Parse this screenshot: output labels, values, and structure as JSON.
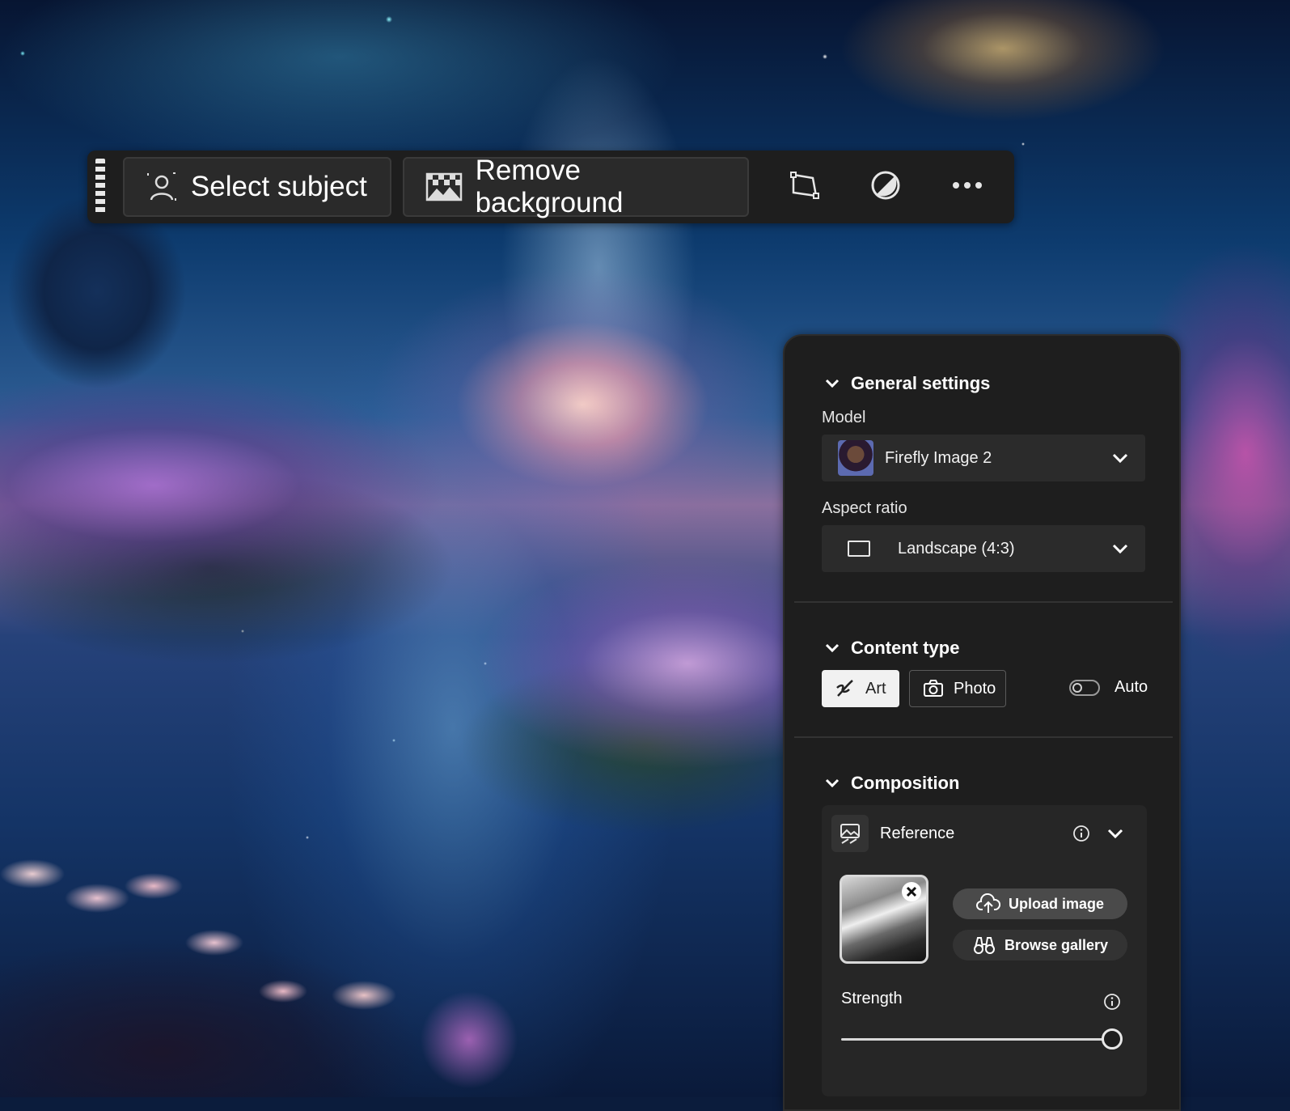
{
  "taskbar": {
    "select_subject_label": "Select subject",
    "remove_background_label": "Remove background"
  },
  "panel": {
    "general_settings": {
      "title": "General settings",
      "model_label": "Model",
      "model_value": "Firefly Image 2",
      "aspect_ratio_label": "Aspect ratio",
      "aspect_ratio_value": "Landscape (4:3)"
    },
    "content_type": {
      "title": "Content type",
      "art_label": "Art",
      "photo_label": "Photo",
      "selected": "Art",
      "auto_label": "Auto",
      "auto_enabled": false
    },
    "composition": {
      "title": "Composition",
      "reference_label": "Reference",
      "upload_label": "Upload image",
      "browse_label": "Browse gallery",
      "strength_label": "Strength",
      "strength_value": 1.0
    }
  },
  "icons": {
    "taskbar": [
      "select-subject-icon",
      "remove-background-icon",
      "transform-icon",
      "adjust-icon",
      "more-icon"
    ],
    "panel": [
      "chevron-down-icon",
      "aspect-ratio-icon",
      "art-brush-icon",
      "camera-icon",
      "reference-image-icon",
      "info-icon",
      "close-icon",
      "upload-cloud-icon",
      "binoculars-icon"
    ]
  },
  "colors": {
    "panel_bg": "#1e1e1e",
    "control_bg": "#2b2b2b",
    "selected_segment_bg": "#f1f1f1",
    "text": "#ffffff"
  }
}
